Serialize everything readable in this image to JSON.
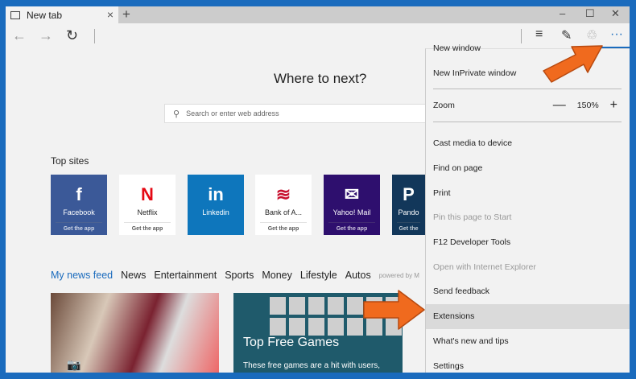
{
  "tab": {
    "title": "New tab",
    "close": "×",
    "new": "+"
  },
  "window_controls": {
    "minimize": "–",
    "maximize": "☐",
    "close": "✕"
  },
  "toolbar": {
    "back": "←",
    "forward": "→",
    "refresh": "↻",
    "hub": "≡",
    "note": "✎",
    "share": "♲",
    "more": "···"
  },
  "page": {
    "heading": "Where to next?",
    "search_placeholder": "Search or enter web address",
    "top_sites_label": "Top sites"
  },
  "tiles": [
    {
      "name": "Facebook",
      "logo": "f",
      "get": "Get the app",
      "bg": "#3b5998",
      "fg": "#ffffff"
    },
    {
      "name": "Netflix",
      "logo": "N",
      "get": "Get the app",
      "bg": "#ffffff",
      "fg": "#222222"
    },
    {
      "name": "Linkedin",
      "logo": "in",
      "get": "",
      "bg": "#0e76bc",
      "fg": "#ffffff"
    },
    {
      "name": "Bank of A...",
      "logo": "≋",
      "get": "Get the app",
      "bg": "#ffffff",
      "fg": "#222222"
    },
    {
      "name": "Yahoo! Mail",
      "logo": "✉",
      "get": "Get the app",
      "bg": "#2e0f6e",
      "fg": "#ffffff"
    },
    {
      "name": "Pando",
      "logo": "P",
      "get": "Get the",
      "bg": "#12375a",
      "fg": "#ffffff"
    }
  ],
  "feed": {
    "tabs": [
      "My news feed",
      "News",
      "Entertainment",
      "Sports",
      "Money",
      "Lifestyle",
      "Autos"
    ],
    "powered": "powered by M"
  },
  "cards": {
    "games_title": "Top Free Games",
    "games_sub": "These free games are a hit with users,"
  },
  "menu": {
    "new_window": "New window",
    "inprivate": "New InPrivate window",
    "zoom": "Zoom",
    "zoom_minus": "—",
    "zoom_value": "150%",
    "zoom_plus": "+",
    "cast": "Cast media to device",
    "find": "Find on page",
    "print": "Print",
    "pin": "Pin this page to Start",
    "f12": "F12 Developer Tools",
    "ie": "Open with Internet Explorer",
    "feedback": "Send feedback",
    "extensions": "Extensions",
    "whatsnew": "What's new and tips",
    "settings": "Settings"
  },
  "colors": {
    "accent": "#1a6bbd",
    "arrow": "#f06a1e"
  }
}
